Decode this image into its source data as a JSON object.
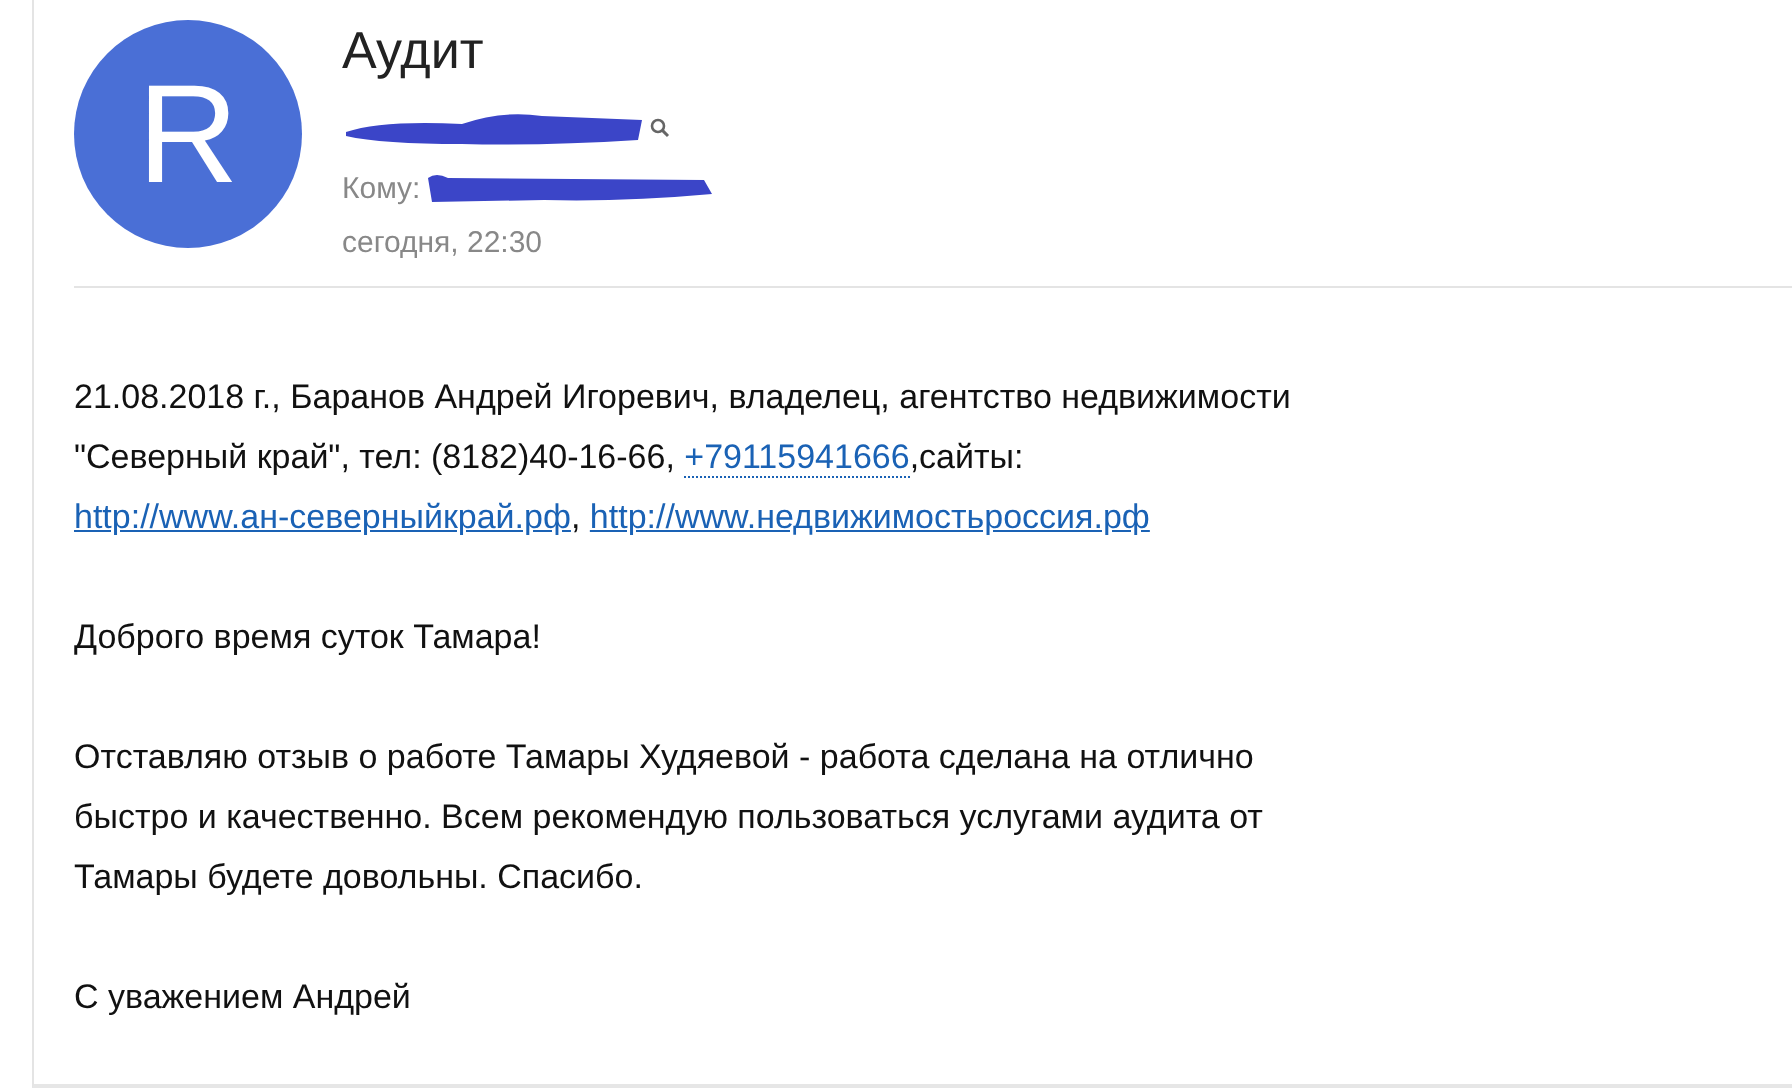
{
  "avatar": {
    "letter": "R"
  },
  "subject": "Аудит",
  "recipient_label": "Кому:",
  "date": "сегодня, 22:30",
  "body": [
    {
      "lines": [
        [
          {
            "kind": "text",
            "text": "21.08.2018 г., Баранов Андрей Игоревич, владелец, агентство недвижимости"
          }
        ],
        [
          {
            "kind": "text",
            "text": "\"Северный край\", тел: (8182)40-16-66, "
          },
          {
            "kind": "phone",
            "text": "+79115941666"
          },
          {
            "kind": "text",
            "text": ",сайты:"
          }
        ],
        [
          {
            "kind": "link",
            "text": "http://www.ан-северныйкрай.рф"
          },
          {
            "kind": "text",
            "text": ", "
          },
          {
            "kind": "link",
            "text": "http://www.недвижимостьроссия.рф"
          }
        ]
      ]
    },
    {
      "lines": [
        [
          {
            "kind": "text",
            "text": "Доброго время суток Тамара!"
          }
        ]
      ]
    },
    {
      "lines": [
        [
          {
            "kind": "text",
            "text": "Отставляю отзыв о работе Тамары Худяевой - работа сделана на отлично"
          }
        ],
        [
          {
            "kind": "text",
            "text": "быстро и качественно. Всем рекомендую пользоваться услугами аудита от"
          }
        ],
        [
          {
            "kind": "text",
            "text": "Тамары будете довольны. Спасибо."
          }
        ]
      ]
    },
    {
      "lines": [
        [
          {
            "kind": "text",
            "text": "С уважением Андрей"
          }
        ]
      ]
    }
  ]
}
